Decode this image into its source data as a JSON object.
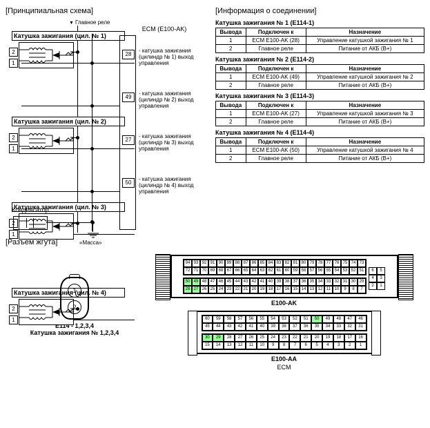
{
  "titles": {
    "schematic": "[Принципиальная схема]",
    "connInfo": "[Информация о соединении]",
    "harness": "[Разъем жгута]",
    "relay": "Главное реле",
    "ecm": "ECM (E100-AK)",
    "capacitor": "Конденсатор",
    "ground": "«Масса»"
  },
  "coils": [
    {
      "title": "Катушка зажигания (цил. № 1)",
      "ecmPin": "28",
      "desc": "- катушка зажигания (цилиндр № 1) выход управления"
    },
    {
      "title": "Катушка зажигания (цил. № 2)",
      "ecmPin": "49",
      "desc": "- катушка зажигания (цилиндр № 2) выход управления"
    },
    {
      "title": "Катушка зажигания (цил. № 3)",
      "ecmPin": "27",
      "desc": "- катушка зажигания (цилиндр № 3) выход управления"
    },
    {
      "title": "Катушка зажигания (цил. № 4)",
      "ecmPin": "50",
      "desc": "- катушка зажигания (цилиндр № 4) выход управления"
    }
  ],
  "connTables": [
    {
      "title": "Катушка зажигания № 1 (E114-1)",
      "rows": [
        {
          "pin": "1",
          "to": "ECM E100-AK (28)",
          "purpose": "Управление катушкой зажигания № 1"
        },
        {
          "pin": "2",
          "to": "Главное реле",
          "purpose": "Питание от АКБ (B+)"
        }
      ]
    },
    {
      "title": "Катушка зажигания № 2 (E114-2)",
      "rows": [
        {
          "pin": "1",
          "to": "ECM E100-AK (49)",
          "purpose": "Управление катушкой зажигания № 2"
        },
        {
          "pin": "2",
          "to": "Главное реле",
          "purpose": "Питание от АКБ (B+)"
        }
      ]
    },
    {
      "title": "Катушка зажигания № 3 (E114-3)",
      "rows": [
        {
          "pin": "1",
          "to": "ECM E100-AK (27)",
          "purpose": "Управление катушкой зажигания № 3"
        },
        {
          "pin": "2",
          "to": "Главное реле",
          "purpose": "Питание от АКБ (B+)"
        }
      ]
    },
    {
      "title": "Катушка зажигания № 4 (E114-4)",
      "rows": [
        {
          "pin": "1",
          "to": "ECM E100-AK (50)",
          "purpose": "Управление катушкой зажигания № 4"
        },
        {
          "pin": "2",
          "to": "Главное реле",
          "purpose": "Питание от АКБ (B+)"
        }
      ]
    }
  ],
  "connHeaders": {
    "pin": "Вывода",
    "to": "Подключен к",
    "purpose": "Назначение"
  },
  "harnessConn": {
    "label1": "E114 - 1,2,3,4",
    "label2": "Катушка зажигания № 1,2,3,4",
    "pins": [
      "1",
      "2"
    ]
  },
  "ecmConnectors": {
    "big": {
      "label": "E100-AK",
      "rows": [
        [
          94,
          93,
          92,
          91,
          90,
          89,
          88,
          87,
          86,
          85,
          84,
          83,
          82,
          81,
          80,
          79,
          78,
          77,
          76,
          75,
          74,
          73
        ],
        [
          72,
          71,
          70,
          69,
          68,
          67,
          66,
          65,
          64,
          63,
          62,
          61,
          60,
          59,
          58,
          57,
          56,
          55,
          54,
          53,
          52,
          51
        ],
        [
          50,
          49,
          48,
          47,
          46,
          45,
          44,
          43,
          42,
          41,
          40,
          39,
          38,
          37,
          36,
          35,
          34,
          33,
          32,
          31,
          30,
          29
        ],
        [
          28,
          27,
          26,
          25,
          24,
          23,
          22,
          21,
          20,
          19,
          18,
          17,
          16,
          15,
          14,
          13,
          12,
          11,
          10,
          9,
          8,
          7
        ]
      ],
      "side": [
        [
          6,
          5
        ],
        [
          4,
          3
        ],
        [
          2,
          1
        ]
      ],
      "highlight": [
        28,
        49,
        27,
        50
      ]
    },
    "small": {
      "label": "E100-AA",
      "sublabel": "ECM",
      "rows": [
        [
          60,
          59,
          58,
          57,
          56,
          55,
          54,
          53,
          52,
          51,
          50,
          49,
          48,
          47,
          46
        ],
        [
          45,
          44,
          43,
          42,
          41,
          40,
          39,
          38,
          37,
          36,
          35,
          34,
          33,
          32,
          31
        ],
        [
          30,
          29,
          28,
          27,
          26,
          25,
          24,
          23,
          22,
          21,
          20,
          19,
          18,
          17,
          16
        ],
        [
          15,
          14,
          13,
          12,
          11,
          10,
          9,
          8,
          7,
          6,
          5,
          4,
          3,
          2,
          1
        ]
      ],
      "highlight": [
        50,
        29,
        30
      ]
    }
  }
}
